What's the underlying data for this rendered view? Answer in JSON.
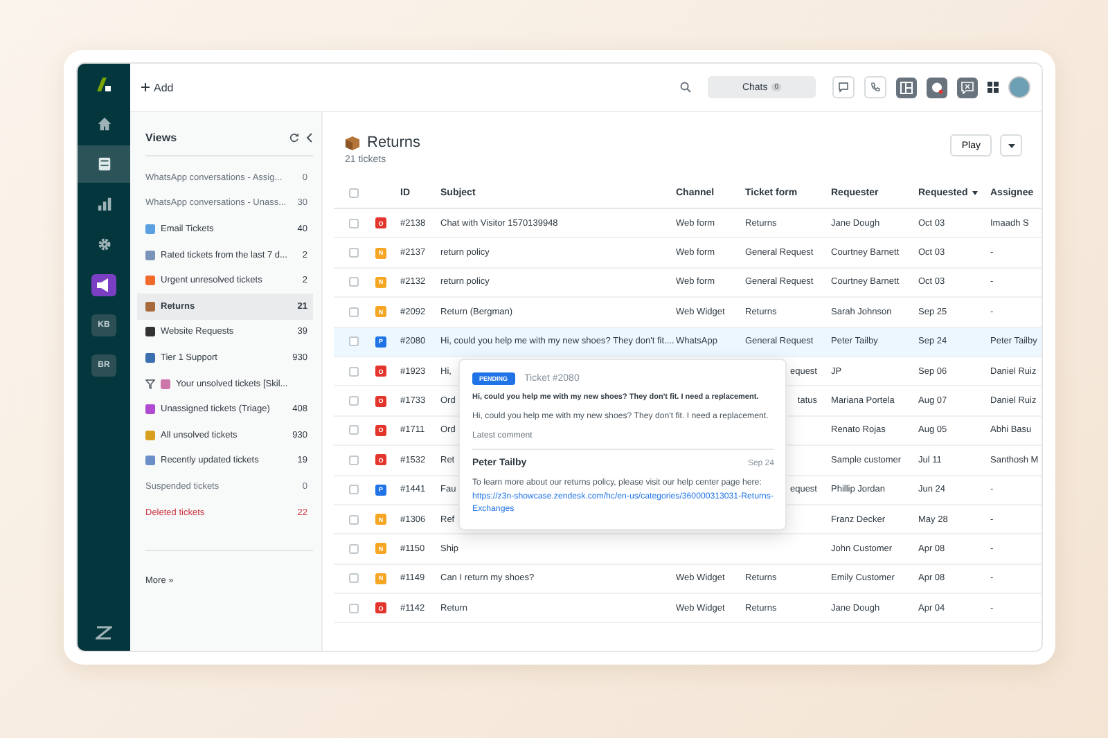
{
  "nav": {
    "items": [
      {
        "kind": "home",
        "selected": false
      },
      {
        "kind": "tickets",
        "selected": true
      },
      {
        "kind": "reports",
        "selected": false
      },
      {
        "kind": "settings",
        "selected": false
      },
      {
        "kind": "campaign",
        "selected": false
      },
      {
        "kind": "text",
        "label": "KB",
        "selected": false
      },
      {
        "kind": "text",
        "label": "BR",
        "selected": false
      }
    ]
  },
  "topbar": {
    "add_label": "Add",
    "chats": {
      "label": "Chats",
      "count": "0"
    }
  },
  "views": {
    "title": "Views",
    "items": [
      {
        "kind": "plain",
        "label": "WhatsApp conversations - Assig...",
        "count": "0",
        "selected": false
      },
      {
        "kind": "plain",
        "label": "WhatsApp conversations - Unass...",
        "count": "30",
        "selected": false
      },
      {
        "kind": "icon",
        "label": "Email Tickets",
        "count": "40",
        "selected": false
      },
      {
        "kind": "icon",
        "label": "Rated tickets from the last 7 d...",
        "count": "2",
        "selected": false
      },
      {
        "kind": "icon",
        "label": "Urgent unresolved tickets",
        "count": "2",
        "selected": false
      },
      {
        "kind": "icon",
        "label": "Returns",
        "count": "21",
        "selected": true
      },
      {
        "kind": "icon",
        "label": "Website Requests",
        "count": "39",
        "selected": false
      },
      {
        "kind": "icon",
        "label": "Tier 1 Support",
        "count": "930",
        "selected": false
      },
      {
        "kind": "filter",
        "label": "Your unsolved tickets [Skil...",
        "selected": false
      },
      {
        "kind": "icon",
        "label": "Unassigned tickets (Triage)",
        "count": "408",
        "selected": false
      },
      {
        "kind": "icon",
        "label": "All unsolved tickets",
        "count": "930",
        "selected": false
      },
      {
        "kind": "icon",
        "label": "Recently updated tickets",
        "count": "19",
        "selected": false
      },
      {
        "kind": "muted",
        "label": "Suspended tickets",
        "count": "0",
        "selected": false
      },
      {
        "kind": "danger",
        "label": "Deleted tickets",
        "count": "22",
        "selected": false
      }
    ],
    "more": "More »"
  },
  "main": {
    "title": "Returns",
    "subtitle": "21 tickets",
    "play": "Play"
  },
  "table": {
    "select_all": {
      "checked": false
    },
    "columns": [
      {
        "label": "ID",
        "sorted": false
      },
      {
        "label": "Subject",
        "sorted": false
      },
      {
        "label": "Channel",
        "sorted": false
      },
      {
        "label": "Ticket form",
        "sorted": false
      },
      {
        "label": "Requester",
        "sorted": false
      },
      {
        "label": "Requested",
        "sorted": true
      },
      {
        "label": "Assignee",
        "sorted": false
      }
    ],
    "rows": [
      {
        "status": "O",
        "color": "#e3352b",
        "id": "#2138",
        "subject": "Chat with Visitor 1570139948",
        "channel": "Web form",
        "form": "Returns",
        "requester": "Jane Dough",
        "requested": "Oct 03",
        "assignee": "Imaadh S",
        "selected": false
      },
      {
        "status": "N",
        "color": "#f5a623",
        "id": "#2137",
        "subject": "return policy",
        "channel": "Web form",
        "form": "General Request",
        "requester": "Courtney Barnett",
        "requested": "Oct 03",
        "assignee": "-",
        "selected": false
      },
      {
        "status": "N",
        "color": "#f5a623",
        "id": "#2132",
        "subject": "return policy",
        "channel": "Web form",
        "form": "General Request",
        "requester": "Courtney Barnett",
        "requested": "Oct 03",
        "assignee": "-",
        "selected": false
      },
      {
        "status": "N",
        "color": "#f5a623",
        "id": "#2092",
        "subject": "Return (Bergman)",
        "channel": "Web Widget",
        "form": "Returns",
        "requester": "Sarah Johnson",
        "requested": "Sep 25",
        "assignee": "-",
        "selected": false
      },
      {
        "status": "P",
        "color": "#1f73e6",
        "id": "#2080",
        "subject": "Hi, could you help me with my new shoes? They don't fit....",
        "channel": "WhatsApp",
        "form": "General Request",
        "requester": "Peter Tailby",
        "requested": "Sep 24",
        "assignee": "Peter Tailby",
        "selected": true
      },
      {
        "status": "O",
        "color": "#e3352b",
        "id": "#1923",
        "subject": "Hi,",
        "form": "equest",
        "form_partial": true,
        "requester": "JP",
        "requested": "Sep 06",
        "assignee": "Daniel Ruiz",
        "selected": false
      },
      {
        "status": "O",
        "color": "#e3352b",
        "id": "#1733",
        "subject": "Ord",
        "form": "tatus",
        "form_partial": true,
        "requester": "Mariana Portela",
        "requested": "Aug 07",
        "assignee": "Daniel Ruiz",
        "selected": false
      },
      {
        "status": "O",
        "color": "#e3352b",
        "id": "#1711",
        "subject": "Ord",
        "requester": "Renato Rojas",
        "requested": "Aug 05",
        "assignee": "Abhi Basu",
        "selected": false
      },
      {
        "status": "O",
        "color": "#e3352b",
        "id": "#1532",
        "subject": "Ret",
        "requester": "Sample customer",
        "requested": "Jul 11",
        "assignee": "Santhosh M",
        "selected": false
      },
      {
        "status": "P",
        "color": "#1f73e6",
        "id": "#1441",
        "subject": "Fau",
        "form": "equest",
        "form_partial": true,
        "requester": "Phillip Jordan",
        "requested": "Jun 24",
        "assignee": "-",
        "selected": false
      },
      {
        "status": "N",
        "color": "#f5a623",
        "id": "#1306",
        "subject": "Ref",
        "requester": "Franz Decker",
        "requested": "May 28",
        "assignee": "-",
        "selected": false
      },
      {
        "status": "N",
        "color": "#f5a623",
        "id": "#1150",
        "subject": "Ship",
        "requester": "John Customer",
        "requested": "Apr 08",
        "assignee": "-",
        "selected": false
      },
      {
        "status": "N",
        "color": "#f5a623",
        "id": "#1149",
        "subject": "Can I return my shoes?",
        "channel": "Web Widget",
        "form": "Returns",
        "requester": "Emily Customer",
        "requested": "Apr 08",
        "assignee": "-",
        "selected": false
      },
      {
        "status": "O",
        "color": "#e3352b",
        "id": "#1142",
        "subject": "Return",
        "channel": "Web Widget",
        "form": "Returns",
        "requester": "Jane Dough",
        "requested": "Apr 04",
        "assignee": "-",
        "selected": false
      }
    ]
  },
  "popover": {
    "badge": "PENDING",
    "ticket": "Ticket #2080",
    "subject": "Hi, could you help me with my new shoes? They don't fit. I need a replacement.",
    "description": "Hi, could you help me with my new shoes? They don't fit. I need a replacement.",
    "section": "Latest comment",
    "author": "Peter Tailby",
    "date": "Sep 24",
    "comment": "To learn more about our returns policy, please visit our help center page here:",
    "link": "https://z3n-showcase.zendesk.com/hc/en-us/categories/360000313031-Returns-Exchanges"
  }
}
